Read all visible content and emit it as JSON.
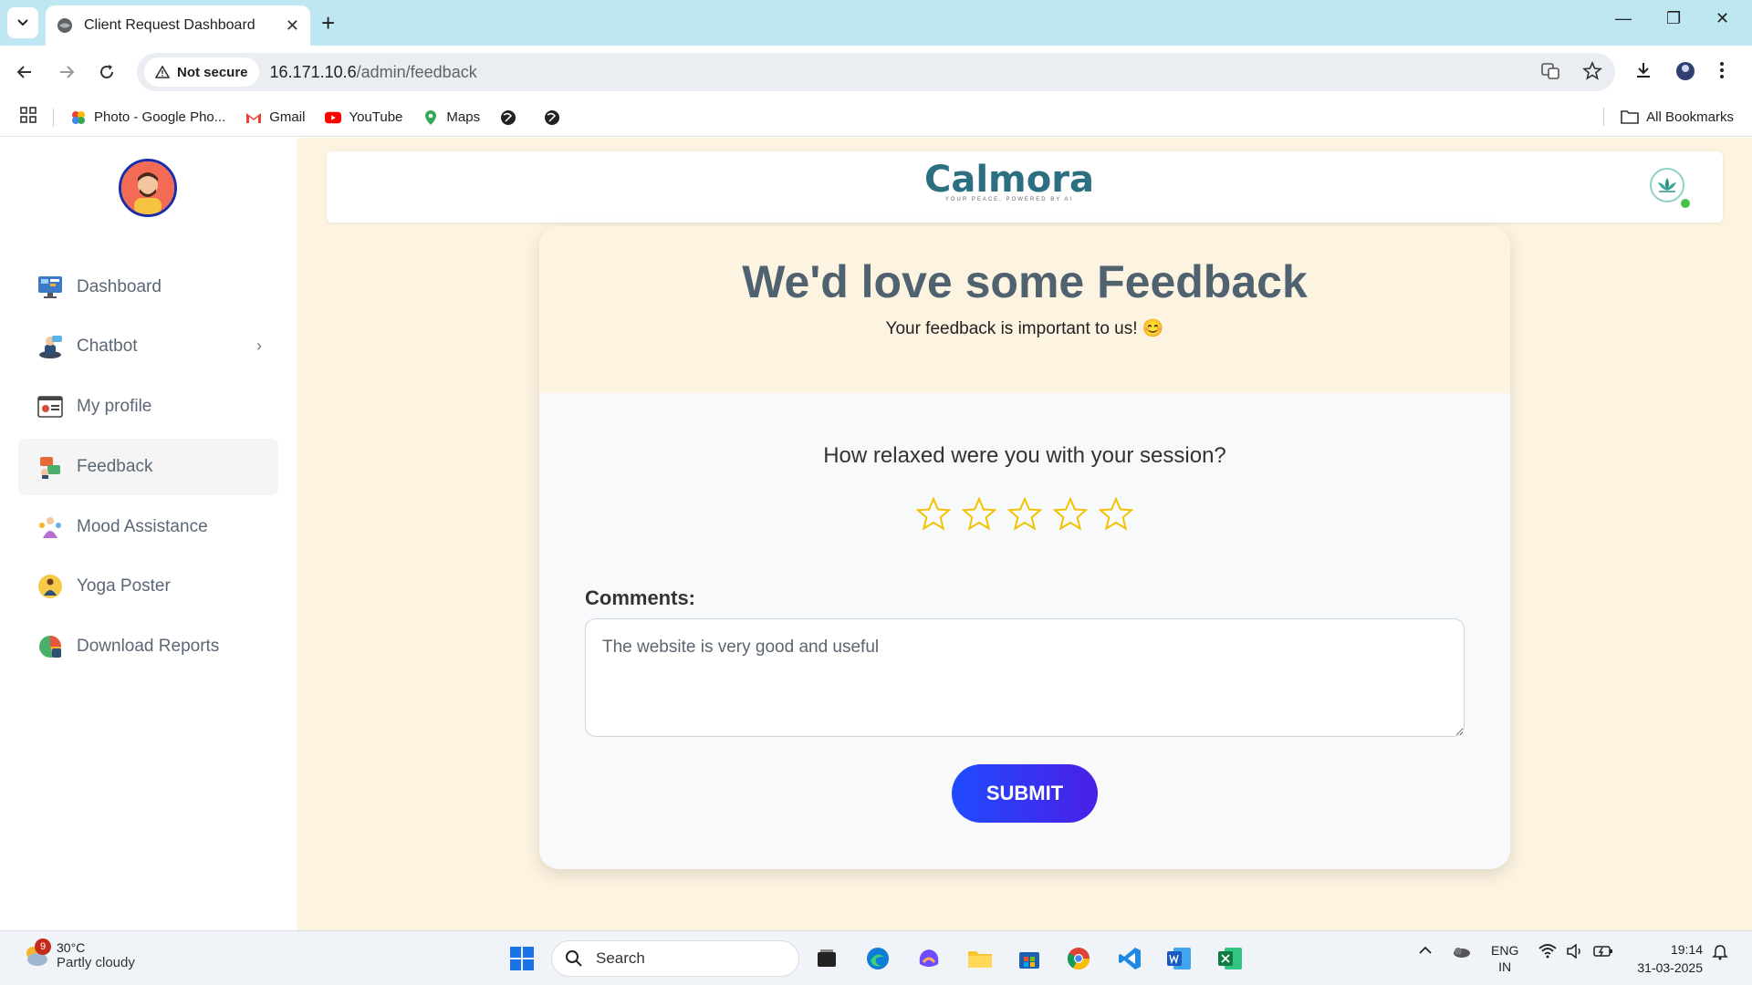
{
  "browser": {
    "tab_title": "Client Request Dashboard",
    "security_label": "Not secure",
    "url_host": "16.171.10.6",
    "url_path": "/admin/feedback",
    "bookmarks": [
      "Photo - Google Pho...",
      "Gmail",
      "YouTube",
      "Maps"
    ],
    "all_bookmarks": "All Bookmarks"
  },
  "sidebar": {
    "items": [
      {
        "label": "Dashboard",
        "icon": "dashboard-icon"
      },
      {
        "label": "Chatbot",
        "icon": "chatbot-icon"
      },
      {
        "label": "My profile",
        "icon": "profile-icon"
      },
      {
        "label": "Feedback",
        "icon": "feedback-icon"
      },
      {
        "label": "Mood Assistance",
        "icon": "mood-icon"
      },
      {
        "label": "Yoga Poster",
        "icon": "yoga-icon"
      },
      {
        "label": "Download Reports",
        "icon": "reports-icon"
      }
    ],
    "active": "Feedback"
  },
  "header": {
    "brand": "Calmora",
    "tagline": "YOUR PEACE, POWERED BY AI"
  },
  "feedback": {
    "title": "We'd love some Feedback",
    "subtitle": "Your feedback is important to us! 😊",
    "question": "How relaxed were you with your session?",
    "rating": 0,
    "max_rating": 5,
    "comments_label": "Comments:",
    "comments_value": "The website is very good and useful",
    "submit_label": "SUBMIT"
  },
  "colors": {
    "accent": "#1f4bff",
    "star": "#f2c200",
    "page_bg": "#fdf3e1",
    "title": "#506170"
  },
  "taskbar": {
    "weather_temp": "30°C",
    "weather_desc": "Partly cloudy",
    "weather_badge": "9",
    "search_placeholder": "Search",
    "lang_line1": "ENG",
    "lang_line2": "IN",
    "time": "19:14",
    "date": "31-03-2025"
  }
}
